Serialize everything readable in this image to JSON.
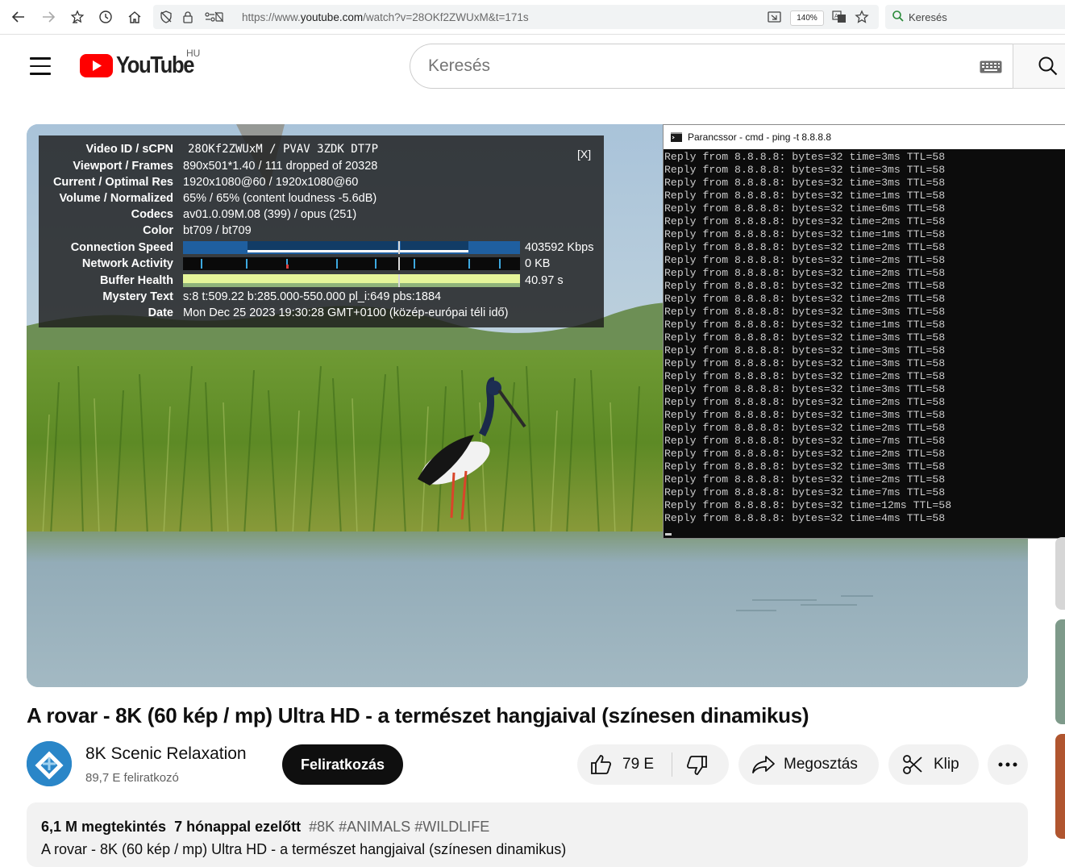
{
  "browser": {
    "url_prefix": "https://www.",
    "url_domain": "youtube.com",
    "url_path": "/watch?v=28OKf2ZWUxM&t=171s",
    "zoom": "140%",
    "search_placeholder": "Keresés"
  },
  "header": {
    "logo_text": "YouTube",
    "region": "HU",
    "search_placeholder": "Keresés"
  },
  "stats": {
    "close_label": "[X]",
    "rows": [
      {
        "label": "Video ID / sCPN",
        "value": "28OKf2ZWUxM / PVAV 3ZDK DT7P"
      },
      {
        "label": "Viewport / Frames",
        "value": "890x501*1.40 / 111 dropped of 20328"
      },
      {
        "label": "Current / Optimal Res",
        "value": "1920x1080@60 / 1920x1080@60"
      },
      {
        "label": "Volume / Normalized",
        "value": "65% / 65% (content loudness -5.6dB)"
      },
      {
        "label": "Codecs",
        "value": "av01.0.09M.08 (399) / opus (251)"
      },
      {
        "label": "Color",
        "value": "bt709 / bt709"
      },
      {
        "label": "Connection Speed",
        "value": "403592 Kbps"
      },
      {
        "label": "Network Activity",
        "value": "0 KB"
      },
      {
        "label": "Buffer Health",
        "value": "40.97 s"
      },
      {
        "label": "Mystery Text",
        "value": "s:8 t:509.22 b:285.000-550.000 pl_i:649 pbs:1884"
      },
      {
        "label": "Date",
        "value": "Mon Dec 25 2023 19:30:28 GMT+0100 (közép-európai téli idő)"
      }
    ]
  },
  "cmd": {
    "title": "Parancssor - cmd - ping  -t 8.8.8.8",
    "lines": [
      "Reply from 8.8.8.8: bytes=32 time=3ms TTL=58",
      "Reply from 8.8.8.8: bytes=32 time=3ms TTL=58",
      "Reply from 8.8.8.8: bytes=32 time=3ms TTL=58",
      "Reply from 8.8.8.8: bytes=32 time=1ms TTL=58",
      "Reply from 8.8.8.8: bytes=32 time=6ms TTL=58",
      "Reply from 8.8.8.8: bytes=32 time=2ms TTL=58",
      "Reply from 8.8.8.8: bytes=32 time=1ms TTL=58",
      "Reply from 8.8.8.8: bytes=32 time=2ms TTL=58",
      "Reply from 8.8.8.8: bytes=32 time=2ms TTL=58",
      "Reply from 8.8.8.8: bytes=32 time=2ms TTL=58",
      "Reply from 8.8.8.8: bytes=32 time=2ms TTL=58",
      "Reply from 8.8.8.8: bytes=32 time=2ms TTL=58",
      "Reply from 8.8.8.8: bytes=32 time=3ms TTL=58",
      "Reply from 8.8.8.8: bytes=32 time=1ms TTL=58",
      "Reply from 8.8.8.8: bytes=32 time=3ms TTL=58",
      "Reply from 8.8.8.8: bytes=32 time=3ms TTL=58",
      "Reply from 8.8.8.8: bytes=32 time=3ms TTL=58",
      "Reply from 8.8.8.8: bytes=32 time=2ms TTL=58",
      "Reply from 8.8.8.8: bytes=32 time=3ms TTL=58",
      "Reply from 8.8.8.8: bytes=32 time=2ms TTL=58",
      "Reply from 8.8.8.8: bytes=32 time=3ms TTL=58",
      "Reply from 8.8.8.8: bytes=32 time=2ms TTL=58",
      "Reply from 8.8.8.8: bytes=32 time=7ms TTL=58",
      "Reply from 8.8.8.8: bytes=32 time=2ms TTL=58",
      "Reply from 8.8.8.8: bytes=32 time=3ms TTL=58",
      "Reply from 8.8.8.8: bytes=32 time=2ms TTL=58",
      "Reply from 8.8.8.8: bytes=32 time=7ms TTL=58",
      "Reply from 8.8.8.8: bytes=32 time=12ms TTL=58",
      "Reply from 8.8.8.8: bytes=32 time=4ms TTL=58"
    ]
  },
  "video": {
    "title": "A rovar - 8K (60 kép / mp) Ultra HD - a természet hangjaival (színesen dinamikus)"
  },
  "channel": {
    "name": "8K Scenic Relaxation",
    "subscribers": "89,7 E feliratkozó",
    "subscribe_label": "Feliratkozás"
  },
  "actions": {
    "likes": "79 E",
    "share_label": "Megosztás",
    "clip_label": "Klip"
  },
  "description": {
    "views": "6,1 M megtekintés",
    "age": "7 hónappal ezelőtt",
    "hashtags": "#8K #ANIMALS #WILDLIFE",
    "text": "A rovar - 8K (60 kép / mp) Ultra HD - a természet hangjaival (színesen dinamikus)"
  },
  "colors": {
    "youtube_red": "#ff0000",
    "stats_bar_blue": "#1f5fa0",
    "buffer_green": "#e5f59a"
  }
}
